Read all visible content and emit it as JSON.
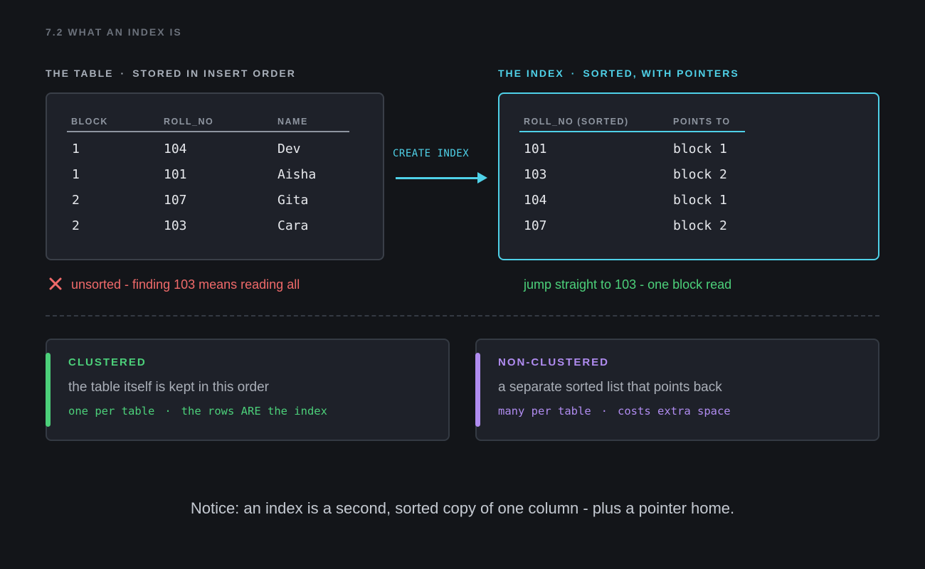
{
  "section_label": "7.2  WHAT AN INDEX IS",
  "table_panel": {
    "title": "THE TABLE",
    "subtitle": "STORED IN INSERT ORDER",
    "separator": "·",
    "columns": [
      "BLOCK",
      "ROLL_NO",
      "NAME"
    ],
    "rows": [
      [
        "1",
        "104",
        "Dev"
      ],
      [
        "1",
        "101",
        "Aisha"
      ],
      [
        "2",
        "107",
        "Gita"
      ],
      [
        "2",
        "103",
        "Cara"
      ]
    ],
    "caption": "unsorted - finding 103 means reading all",
    "caption_icon": "x-icon"
  },
  "arrow": {
    "label": "CREATE INDEX"
  },
  "index_panel": {
    "title": "THE INDEX",
    "subtitle": "SORTED, WITH POINTERS",
    "separator": "·",
    "columns": [
      "ROLL_NO (SORTED)",
      "POINTS TO"
    ],
    "rows": [
      [
        "101",
        "block 1"
      ],
      [
        "103",
        "block 2"
      ],
      [
        "104",
        "block 1"
      ],
      [
        "107",
        "block 2"
      ]
    ],
    "caption": "jump straight to 103 - one block read"
  },
  "clustered": {
    "title": "CLUSTERED",
    "description": "the table itself is kept in this order",
    "note_a": "one per table",
    "note_sep": "·",
    "note_b": "the rows ARE the index"
  },
  "non_clustered": {
    "title": "NON-CLUSTERED",
    "description": "a separate sorted list that points back",
    "note_a": "many per table",
    "note_sep": "·",
    "note_b": "costs extra space"
  },
  "notice": "Notice: an index is a second, sorted copy of one column - plus a pointer home.",
  "colors": {
    "background": "#131519",
    "accent_cyan": "#4fd1e8",
    "bad_red": "#f06a6a",
    "good_green": "#4cd07a",
    "violet": "#b08cf0"
  }
}
